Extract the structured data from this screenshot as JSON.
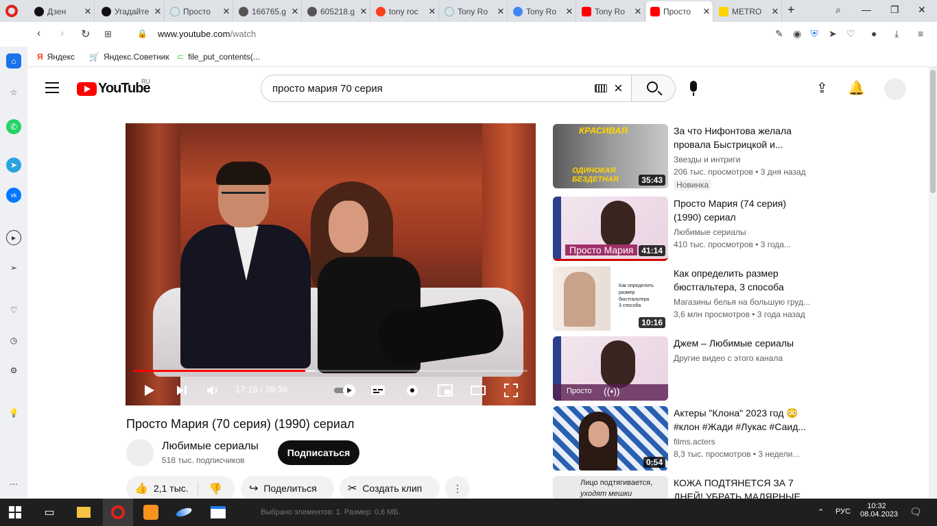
{
  "tabs": [
    {
      "label": "Дзен",
      "active": false
    },
    {
      "label": "Угадайте",
      "active": false
    },
    {
      "label": "Просто",
      "active": false
    },
    {
      "label": "166765.g",
      "active": false
    },
    {
      "label": "605218.g",
      "active": false
    },
    {
      "label": "tony roc",
      "active": false
    },
    {
      "label": "Tony Ro",
      "active": false
    },
    {
      "label": "Tony Ro",
      "active": false
    },
    {
      "label": "Tony Ro",
      "active": false
    },
    {
      "label": "Просто",
      "active": true
    },
    {
      "label": "METRO",
      "active": false
    }
  ],
  "address": {
    "host": "www.youtube.com",
    "path": "/watch"
  },
  "bookmarks": [
    {
      "label": "Яндекс"
    },
    {
      "label": "Яндекс.Советник"
    },
    {
      "label": "file_put_contents(..."
    }
  ],
  "youtube": {
    "logo_text": "YouTube",
    "region": "RU",
    "search_query": "просто мария 70 серия"
  },
  "player": {
    "current_time": "17:16",
    "duration": "39:39",
    "time_display": "17:16 / 39:39",
    "played_fraction": 0.435,
    "loaded_fraction": 0.46
  },
  "video": {
    "title": "Просто Мария (70 серия) (1990) сериал",
    "channel": "Любимые сериалы",
    "subscribers": "518 тыс. подписчиков",
    "subscribe_label": "Подписаться",
    "likes": "2,1 тыс.",
    "share_label": "Поделиться",
    "clip_label": "Создать клип"
  },
  "recommendations": [
    {
      "title": "За что Нифонтова желала провала Быстрицкой и...",
      "channel": "Звезды и интриги",
      "meta": "206 тыс. просмотров • 3 дня назад",
      "duration": "35:43",
      "badge": "Новинка",
      "thumb_top": "КРАСИВАЯ",
      "thumb_bottom": "ОДИНОКАЯ БЕЗДЕТНАЯ"
    },
    {
      "title": "Просто Мария (74 серия) (1990) сериал",
      "channel": "Любимые сериалы",
      "meta": "410 тыс. просмотров • 3 года...",
      "duration": "41:14",
      "badge": "",
      "thumb_top": "",
      "thumb_bottom": "Просто Мария"
    },
    {
      "title": "Как определить размер бюстгальтера, 3 способа",
      "channel": "Магазины белья на большую груд...",
      "meta": "3,6 млн просмотров • 3 года назад",
      "duration": "10:16",
      "badge": "",
      "thumb_top": "Как определить размер бюстгальтера",
      "thumb_bottom": "3 способа"
    },
    {
      "title": "Джем – Любимые сериалы",
      "channel": "Другие видео с этого канала",
      "meta": "",
      "duration": "",
      "badge": "",
      "thumb_top": "",
      "thumb_bottom": "Просто"
    },
    {
      "title": "Актеры \"Клона\" 2023 год 😳 #клон #Жади #Лукас #Саид...",
      "channel": "films.acters",
      "meta": "8,3 тыс. просмотров • 3 недели...",
      "duration": "0:54",
      "badge": "",
      "thumb_top": "",
      "thumb_bottom": ""
    },
    {
      "title": "КОЖА ПОДТЯНЕТСЯ ЗА 7 ДНЕЙ! УБРАТЬ МАЛЯРНЫЕ...",
      "channel": "",
      "meta": "",
      "duration": "",
      "badge": "",
      "thumb_top": "Лицо подтягивается,",
      "thumb_bottom": "уходят мешки"
    }
  ],
  "taskbar": {
    "status": "Выбрано элементов: 1. Размер: 0,6 МБ.",
    "lang": "РУС",
    "time": "10:32",
    "date": "08.04.2023"
  },
  "colors": {
    "yt_red": "#ff0000",
    "opera_red": "#e2231a",
    "taskbar": "#1f1f1f"
  }
}
